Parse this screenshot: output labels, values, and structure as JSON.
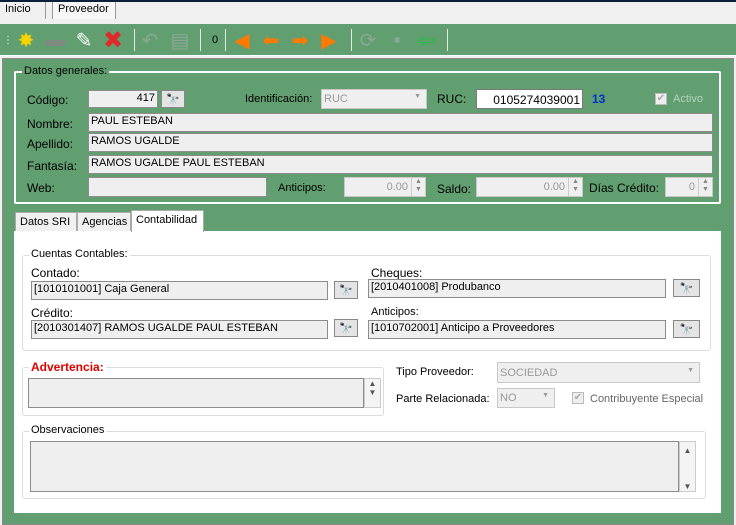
{
  "window_tabs": [
    "Inicio",
    "Proveedor"
  ],
  "toolbar": {
    "counter": "0",
    "icons": [
      "new-icon",
      "save-icon",
      "edit-icon",
      "delete-icon",
      "undo-icon",
      "print-icon",
      "first-icon",
      "previous-icon",
      "next-icon",
      "last-icon",
      "refresh-icon",
      "export-icon",
      "exit-icon"
    ]
  },
  "general": {
    "title": "Datos generales:",
    "codigo_label": "Código:",
    "codigo": "417",
    "identificacion_label": "Identificación:",
    "identificacion": "RUC",
    "ruc_label": "RUC:",
    "ruc": "0105274039001",
    "ruc_length": "13",
    "activo_label": "Activo",
    "nombre_label": "Nombre:",
    "nombre": "PAUL ESTEBAN",
    "apellido_label": "Apellido:",
    "apellido": "RAMOS UGALDE",
    "fantasia_label": "Fantasía:",
    "fantasia": "RAMOS UGALDE PAUL ESTEBAN",
    "web_label": "Web:",
    "web": "",
    "anticipos_label": "Anticipos:",
    "anticipos": "0.00",
    "saldo_label": "Saldo:",
    "saldo": "0.00",
    "dias_label": "Días Crédito:",
    "dias": "0"
  },
  "tabs": [
    "Datos SRI",
    "Agencias",
    "Contabilidad"
  ],
  "cuentas": {
    "title": "Cuentas Contables:",
    "contado_label": "Contado:",
    "contado": "[1010101001] Caja General",
    "cheques_label": "Cheques:",
    "cheques": "[2010401008] Produbanco",
    "credito_label": "Crédito:",
    "credito": "[2010301407] RAMOS UGALDE PAUL ESTEBAN",
    "anticipos_label": "Anticipos:",
    "anticipos": "[1010702001] Anticipo a Proveedores"
  },
  "advertencia": {
    "title": "Advertencia:",
    "value": ""
  },
  "tipo_proveedor_label": "Tipo Proveedor:",
  "tipo_proveedor": "SOCIEDAD",
  "parte_relacionada_label": "Parte Relacionada:",
  "parte_relacionada": "NO",
  "contribuyente_label": "Contribuyente Especial",
  "observaciones": {
    "title": "Observaciones",
    "value": ""
  },
  "colors": {
    "green": "#619e70",
    "warning": "#e00000",
    "count": "#0033cc"
  }
}
